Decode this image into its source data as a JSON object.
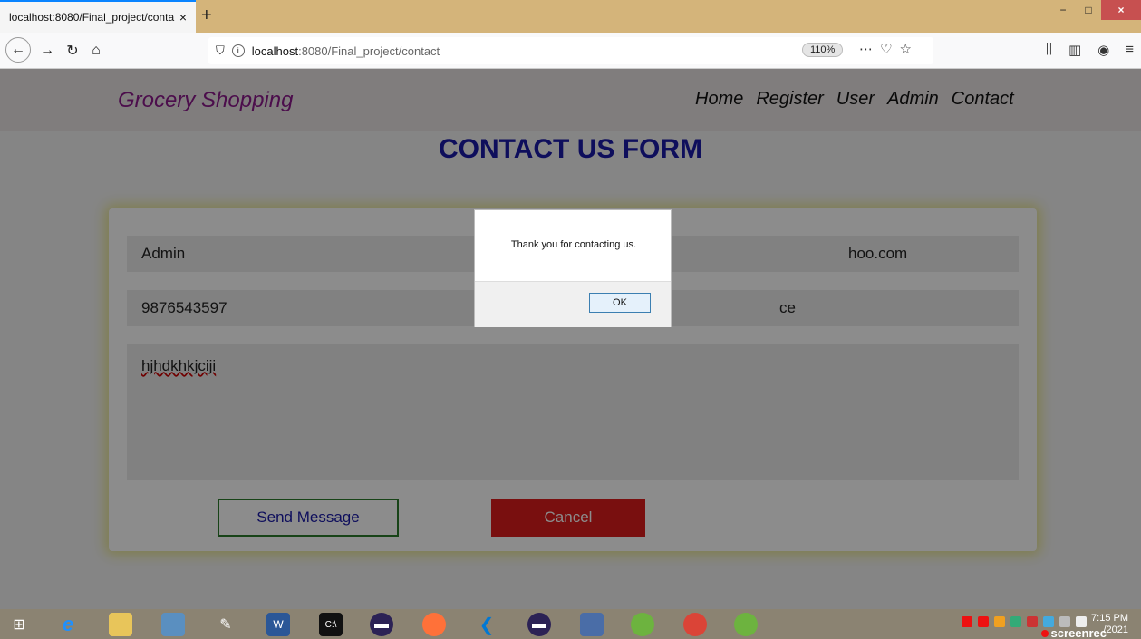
{
  "browser": {
    "tab_title": "localhost:8080/Final_project/conta",
    "tab_close": "×",
    "new_tab": "+",
    "url_host": "localhost",
    "url_path": ":8080/Final_project/contact",
    "zoom": "110%",
    "window_controls": {
      "minimize": "−",
      "maximize": "□",
      "close": "×"
    },
    "icons": [
      "back-icon",
      "forward-icon",
      "reload-icon",
      "home-icon",
      "shield-icon",
      "info-icon",
      "more-icon",
      "pocket-icon",
      "star-icon",
      "library-icon",
      "sidebar-icon",
      "account-icon",
      "menu-icon"
    ]
  },
  "site": {
    "brand": "Grocery Shopping",
    "nav": [
      "Home",
      "Register",
      "User",
      "Admin",
      "Contact"
    ],
    "form_title": "CONTACT US FORM"
  },
  "form": {
    "name": "Admin",
    "email_partial": "hoo.com",
    "phone": "9876543597",
    "subject_partial": "ce",
    "message": "hjhdkhkjciji",
    "send_label": "Send Message",
    "cancel_label": "Cancel"
  },
  "dialog": {
    "message": "Thank you for contacting us.",
    "ok_label": "OK"
  },
  "taskbar": {
    "icons": [
      "windows-start-icon",
      "internet-explorer-icon",
      "file-explorer-icon",
      "notebook-icon",
      "paint-icon",
      "word-icon",
      "cmd-icon",
      "eclipse-icon",
      "firefox-icon",
      "vscode-icon",
      "eclipse-icon",
      "mysql-workbench-icon",
      "spring-icon",
      "chrome-icon",
      "spring-icon"
    ],
    "time": "7:15 PM",
    "date": "/2021",
    "screenrec_label": "screenrec"
  }
}
